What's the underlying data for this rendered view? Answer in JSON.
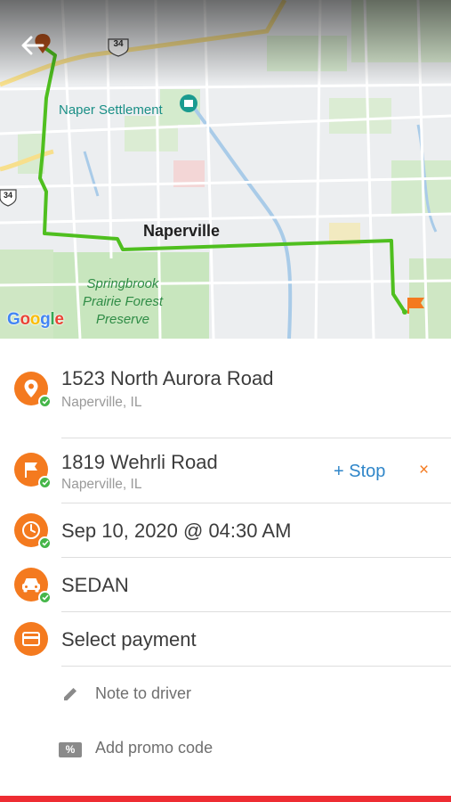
{
  "map": {
    "city_label": "Naperville",
    "poi_label": "Naper Settlement",
    "park_label_lines": [
      "Springbrook",
      "Prairie Forest",
      "Preserve"
    ],
    "shield_34_top": "34",
    "shield_34_left": "34",
    "google_letters": [
      "G",
      "o",
      "o",
      "g",
      "l",
      "e"
    ],
    "google_colors": [
      "#4285F4",
      "#EA4335",
      "#FBBC05",
      "#4285F4",
      "#34A853",
      "#EA4335"
    ],
    "route_color": "#4fbf1f"
  },
  "pickup": {
    "address": "1523 North Aurora Road",
    "city": "Naperville, IL"
  },
  "dropoff": {
    "address": "1819 Wehrli Road",
    "city": "Naperville, IL",
    "add_stop_label": "+ Stop",
    "remove_label": "×"
  },
  "schedule": {
    "datetime": "Sep 10, 2020 @ 04:30 AM"
  },
  "vehicle": {
    "type": "SEDAN"
  },
  "payment": {
    "label": "Select payment"
  },
  "note": {
    "label": "Note to driver"
  },
  "promo": {
    "label": "Add promo code",
    "icon_text": "%"
  },
  "colors": {
    "accent": "#f47a1f",
    "check": "#45b649",
    "link": "#2f86c9",
    "bottom_bar": "#ee2c32"
  }
}
